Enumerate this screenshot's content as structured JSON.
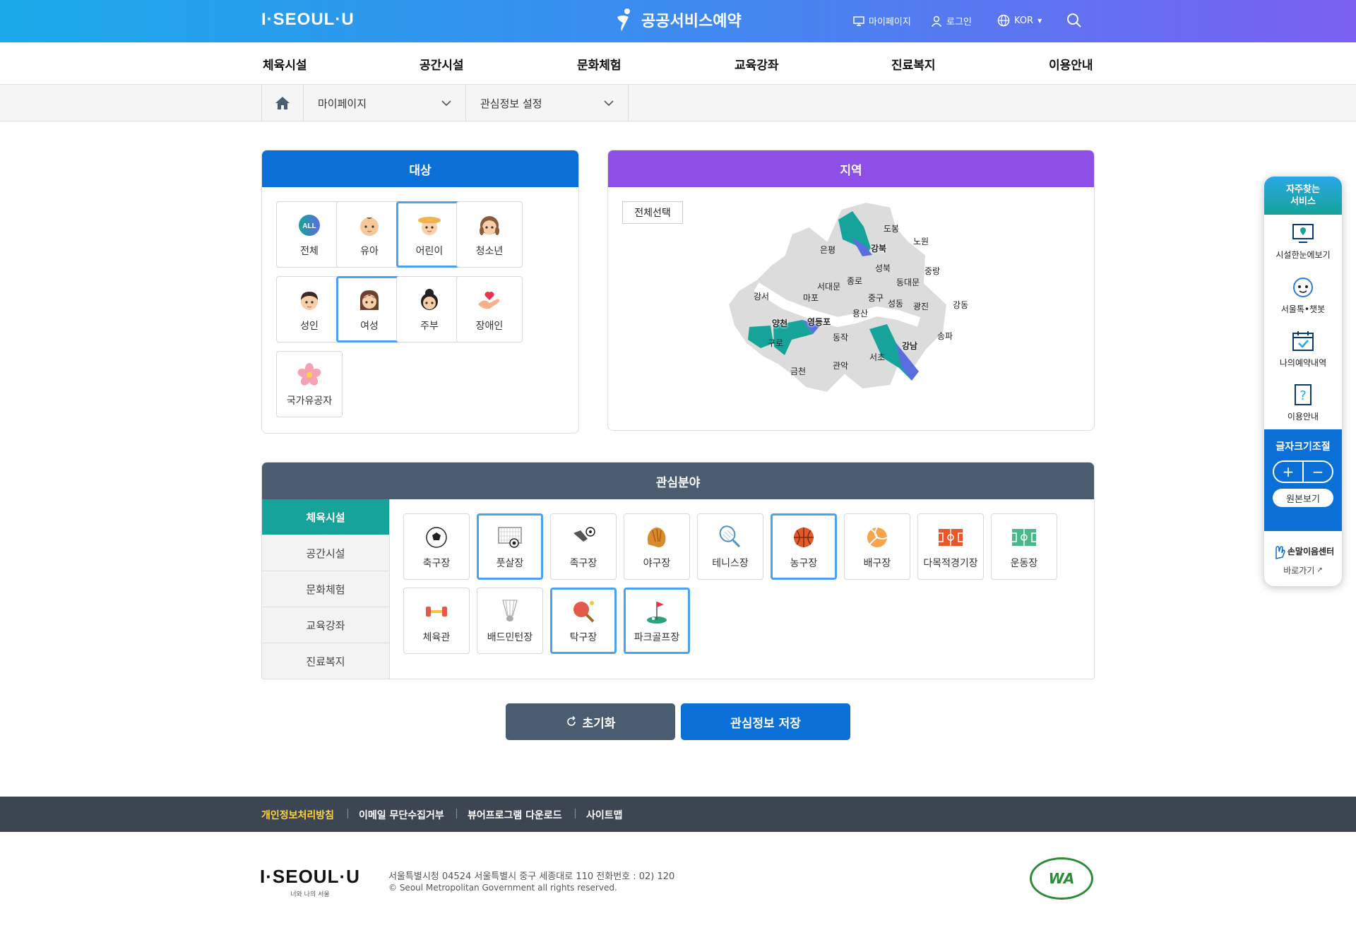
{
  "header": {
    "logo": "I·SEOUL·U",
    "brand": "공공서비스예약",
    "mypage": "마이페이지",
    "login": "로그인",
    "lang": "KOR"
  },
  "gnb": [
    "체육시설",
    "공간시설",
    "문화체험",
    "교육강좌",
    "진료복지",
    "이용안내"
  ],
  "breadcrumb": {
    "level1": "마이페이지",
    "level2": "관심정보 설정"
  },
  "target": {
    "title": "대상",
    "items": [
      {
        "label": "전체",
        "icon": "all-badge-icon",
        "selected": false
      },
      {
        "label": "유아",
        "icon": "baby-icon",
        "selected": false
      },
      {
        "label": "어린이",
        "icon": "child-icon",
        "selected": true
      },
      {
        "label": "청소년",
        "icon": "teen-icon",
        "selected": false
      },
      {
        "label": "성인",
        "icon": "adult-icon",
        "selected": false
      },
      {
        "label": "여성",
        "icon": "woman-icon",
        "selected": true
      },
      {
        "label": "주부",
        "icon": "housewife-icon",
        "selected": false
      },
      {
        "label": "장애인",
        "icon": "heart-hand-icon",
        "selected": false
      },
      {
        "label": "국가유공자",
        "icon": "flower-icon",
        "selected": false
      }
    ],
    "all_badge": "ALL"
  },
  "region": {
    "title": "지역",
    "select_all": "전체선택",
    "districts": [
      "도봉",
      "노원",
      "강북",
      "은평",
      "성북",
      "중랑",
      "종로",
      "동대문",
      "서대문",
      "강서",
      "마포",
      "중구",
      "성동",
      "광진",
      "강동",
      "용산",
      "양천",
      "영등포",
      "동작",
      "송파",
      "구로",
      "강남",
      "서초",
      "금천",
      "관악"
    ],
    "selected": [
      "강북",
      "양천",
      "영등포",
      "강남"
    ]
  },
  "interest": {
    "title": "관심분야",
    "tabs": [
      {
        "label": "체육시설",
        "active": true
      },
      {
        "label": "공간시설",
        "active": false
      },
      {
        "label": "문화체험",
        "active": false
      },
      {
        "label": "교육강좌",
        "active": false
      },
      {
        "label": "진료복지",
        "active": false
      }
    ],
    "items": [
      {
        "label": "축구장",
        "icon": "soccer-ball-icon",
        "selected": false
      },
      {
        "label": "풋살장",
        "icon": "futsal-goal-icon",
        "selected": true
      },
      {
        "label": "족구장",
        "icon": "jokgu-icon",
        "selected": false
      },
      {
        "label": "야구장",
        "icon": "baseball-glove-icon",
        "selected": false
      },
      {
        "label": "테니스장",
        "icon": "tennis-racket-icon",
        "selected": false
      },
      {
        "label": "농구장",
        "icon": "basketball-icon",
        "selected": true
      },
      {
        "label": "배구장",
        "icon": "volleyball-icon",
        "selected": false
      },
      {
        "label": "다목적경기장",
        "icon": "multi-court-icon",
        "selected": false
      },
      {
        "label": "운동장",
        "icon": "field-icon",
        "selected": false
      },
      {
        "label": "체육관",
        "icon": "dumbbell-icon",
        "selected": false
      },
      {
        "label": "배드민턴장",
        "icon": "shuttlecock-icon",
        "selected": false
      },
      {
        "label": "탁구장",
        "icon": "ping-pong-icon",
        "selected": true
      },
      {
        "label": "파크골프장",
        "icon": "golf-flag-icon",
        "selected": true
      }
    ]
  },
  "buttons": {
    "reset": "초기화",
    "save": "관심정보 저장"
  },
  "quick": {
    "title": "자주찾는 서비스",
    "items": [
      "시설한눈에보기",
      "서울톡•챗봇",
      "나의예약내역",
      "이용안내"
    ],
    "font_title": "글자크기조절",
    "plus": "+",
    "minus": "−",
    "original": "원본보기",
    "sign": "손말이음센터",
    "go": "바로가기"
  },
  "footer": {
    "links": [
      "개인정보처리방침",
      "이메일 무단수집거부",
      "뷰어프로그램 다운로드",
      "사이트맵"
    ],
    "logo": "I·SEOUL·U",
    "logo_sub": "너와 나의 서울",
    "address": "서울특별시청 04524 서울특별시 중구 세종대로 110 전화번호 : 02) 120",
    "copyright": "© Seoul Metropolitan Government all rights reserved.",
    "wa": "WA"
  },
  "colors": {
    "blue": "#0a6fd6",
    "purple": "#8e4fe6",
    "teal": "#16a39a",
    "slate": "#4a5d70",
    "selected_border": "#4aa3f0",
    "map_gray": "#dcdcdc"
  }
}
